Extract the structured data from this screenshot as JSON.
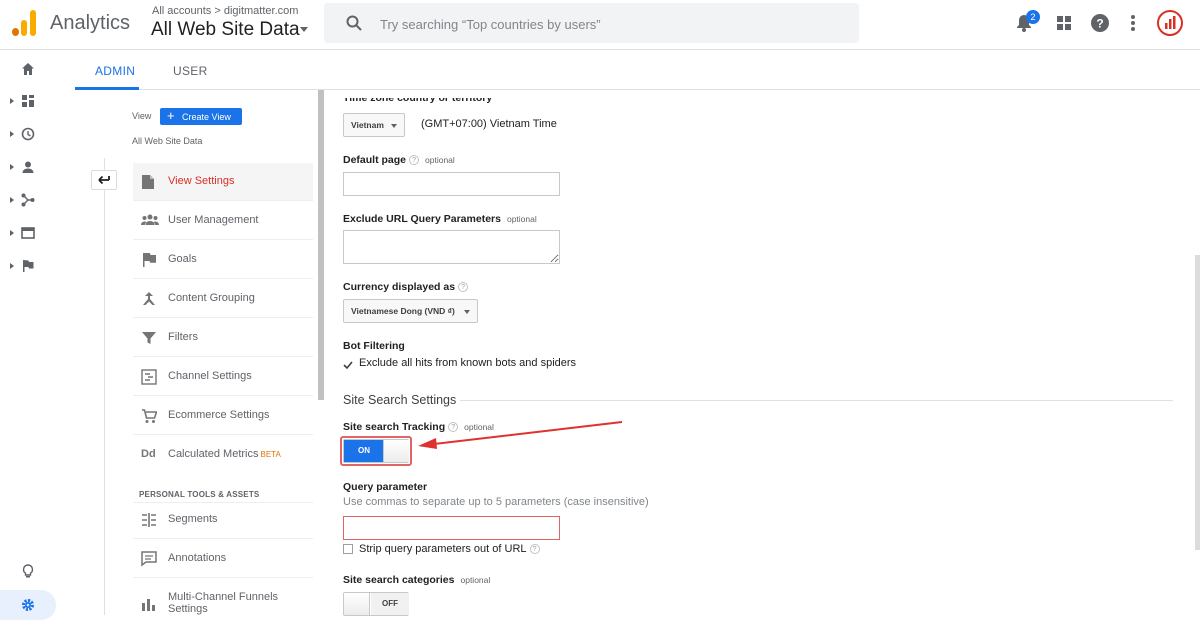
{
  "header": {
    "app_name": "Analytics",
    "account_crumb": "All accounts > digitmatter.com",
    "property_title": "All Web Site Data",
    "search_placeholder": "Try searching “Top countries by users”",
    "notification_count": "2"
  },
  "tabs": {
    "admin": "ADMIN",
    "user": "USER"
  },
  "view_panel": {
    "view_label": "View",
    "create_view": "Create View",
    "view_name": "All Web Site Data"
  },
  "nav": {
    "items": [
      {
        "label": "View Settings",
        "icon": "document-icon",
        "active": true
      },
      {
        "label": "User Management",
        "icon": "people-icon"
      },
      {
        "label": "Goals",
        "icon": "flag-icon"
      },
      {
        "label": "Content Grouping",
        "icon": "grouping-icon"
      },
      {
        "label": "Filters",
        "icon": "filter-icon"
      },
      {
        "label": "Channel Settings",
        "icon": "channel-icon"
      },
      {
        "label": "Ecommerce Settings",
        "icon": "cart-icon"
      },
      {
        "label": "Calculated Metrics",
        "icon": "dd-icon",
        "badge": "BETA"
      }
    ],
    "personal_header": "PERSONAL TOOLS & ASSETS",
    "personal_items": [
      {
        "label": "Segments",
        "icon": "segments-icon"
      },
      {
        "label": "Annotations",
        "icon": "annotation-icon"
      },
      {
        "label": "Multi-Channel Funnels Settings",
        "icon": "bar-chart-icon"
      }
    ]
  },
  "form": {
    "timezone_label_partial": "Time zone country or territory",
    "timezone_country": "Vietnam",
    "timezone_value": "(GMT+07:00) Vietnam Time",
    "default_page_label": "Default page",
    "optional": "optional",
    "exclude_url_label": "Exclude URL Query Parameters",
    "currency_label": "Currency displayed as",
    "currency_value": "Vietnamese Dong (VND ₫)",
    "bot_filtering_label": "Bot Filtering",
    "bot_filtering_checkbox": "Exclude all hits from known bots and spiders",
    "site_search_heading": "Site Search Settings",
    "site_search_tracking_label": "Site search Tracking",
    "tracking_toggle": "ON",
    "query_param_label": "Query parameter",
    "query_param_hint": "Use commas to separate up to 5 parameters (case insensitive)",
    "strip_query_label": "Strip query parameters out of URL",
    "site_search_categories_label": "Site search categories",
    "categories_toggle": "OFF",
    "help_mark": "?"
  },
  "colors": {
    "accent_blue": "#1a73e8",
    "active_red": "#d93025",
    "annotation_red": "#e03131"
  }
}
